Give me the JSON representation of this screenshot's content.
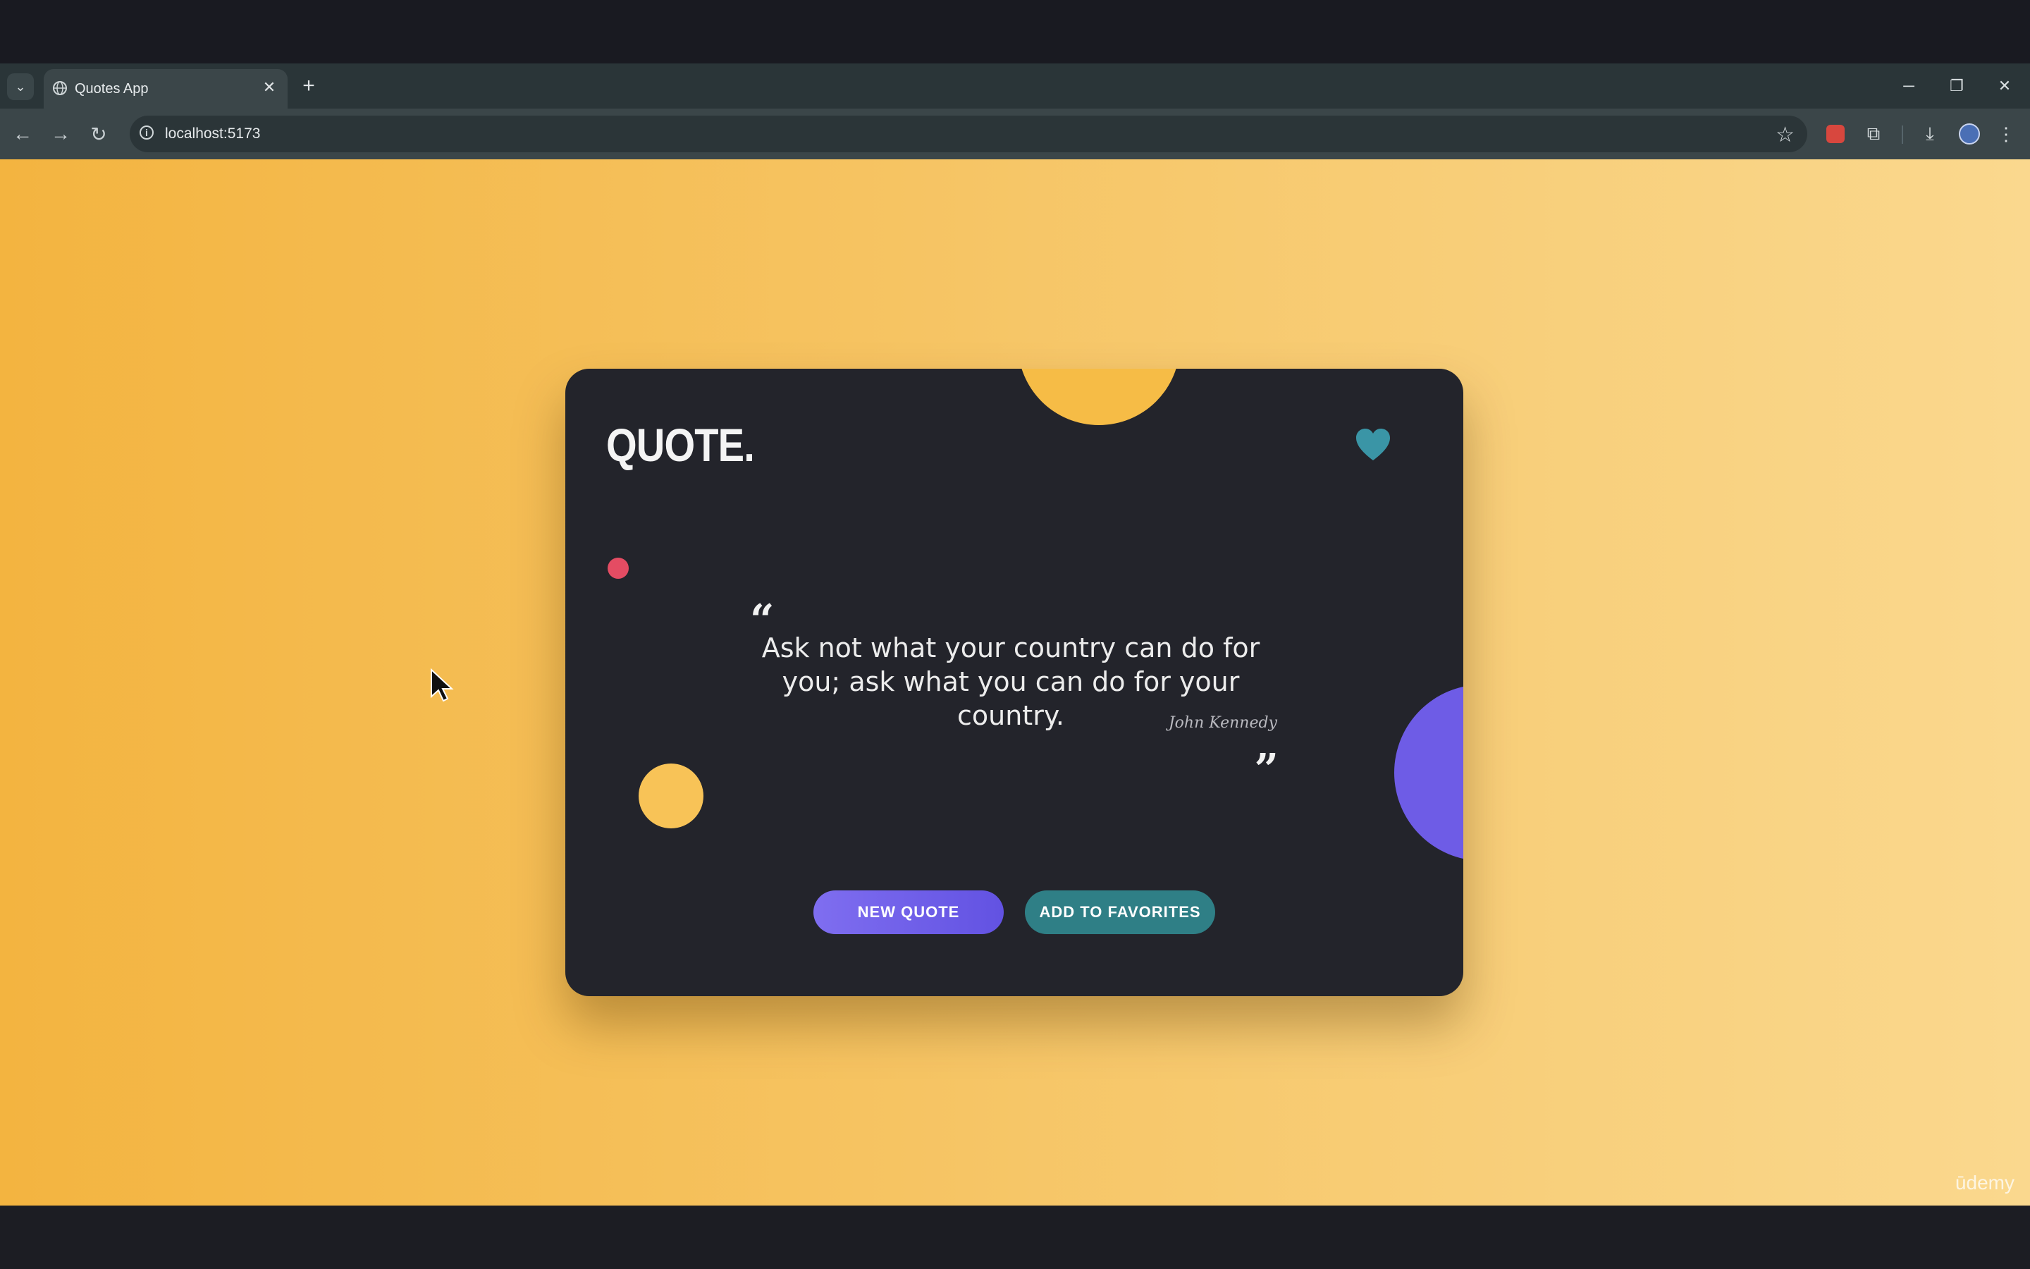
{
  "browser": {
    "tab": {
      "title": "Quotes App"
    },
    "address": {
      "url": "localhost:5173"
    }
  },
  "card": {
    "logo": "QUOTE.",
    "quote_open": "“",
    "quote": "Ask not what your country can do for you; ask what you can do for your country.",
    "author": "John Kennedy",
    "quote_close": "”",
    "new_quote_label": "NEW QUOTE",
    "favorites_label": "ADD TO FAVORITES"
  },
  "watermark": "ūdemy",
  "colors": {
    "card_bg": "#23242b",
    "accent_purple": "#6e5ce6",
    "accent_teal": "#2f7f86",
    "accent_yellow": "#f6bc46",
    "accent_red": "#e44c63"
  },
  "icons": [
    "tab-list-icon",
    "globe-icon",
    "close-icon",
    "plus-icon",
    "back-icon",
    "forward-icon",
    "reload-icon",
    "info-icon",
    "star-icon",
    "extensions-icon",
    "download-icon",
    "menu-icon",
    "heart-icon",
    "cursor-icon"
  ]
}
